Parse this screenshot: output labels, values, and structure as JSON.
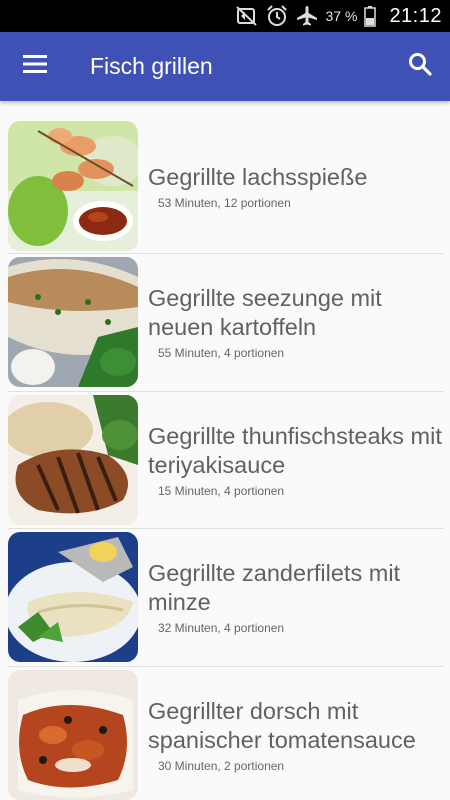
{
  "status_bar": {
    "battery_percent": "37 %",
    "time": "21:12",
    "icons": [
      "mute-icon",
      "alarm-icon",
      "airplane-mode-icon",
      "battery-icon"
    ]
  },
  "app_bar": {
    "title": "Fisch grillen",
    "menu_icon": "hamburger-menu-icon",
    "search_icon": "search-icon",
    "color": "#3f51b5"
  },
  "recipes": [
    {
      "title": "Gegrillte lachsspieße",
      "meta": "53 Minuten, 12 portionen",
      "image": "salmon-skewers-image"
    },
    {
      "title": "Gegrillte seezunge mit neuen kartoffeln",
      "meta": "55 Minuten, 4 portionen",
      "image": "sole-with-potatoes-image"
    },
    {
      "title": "Gegrillte thunfischsteaks mit teriyakisauce",
      "meta": "15 Minuten, 4 portionen",
      "image": "tuna-steak-image"
    },
    {
      "title": "Gegrillte zanderfilets mit minze",
      "meta": "32 Minuten, 4 portionen",
      "image": "zander-fillet-image"
    },
    {
      "title": "Gegrillter dorsch mit spanischer tomatensauce",
      "meta": "30 Minuten, 2 portionen",
      "image": "cod-tomato-sauce-image"
    }
  ]
}
